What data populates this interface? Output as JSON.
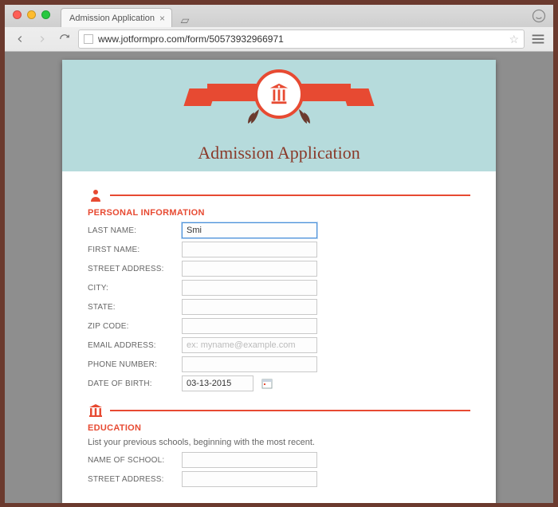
{
  "browser": {
    "tab_title": "Admission Application",
    "url": "www.jotformpro.com/form/50573932966971"
  },
  "banner": {
    "title": "Admission Application"
  },
  "sections": {
    "personal": {
      "title": "PERSONAL INFORMATION",
      "fields": {
        "last_name": {
          "label": "LAST NAME:",
          "value": "Smi"
        },
        "first_name": {
          "label": "FIRST NAME:",
          "value": ""
        },
        "street_address": {
          "label": "STREET ADDRESS:",
          "value": ""
        },
        "city": {
          "label": "CITY:",
          "value": ""
        },
        "state": {
          "label": "STATE:",
          "value": ""
        },
        "zip": {
          "label": "ZIP CODE:",
          "value": ""
        },
        "email": {
          "label": "EMAIL ADDRESS:",
          "value": "",
          "placeholder": "ex: myname@example.com"
        },
        "phone": {
          "label": "PHONE NUMBER:",
          "value": ""
        },
        "dob": {
          "label": "DATE OF BIRTH:",
          "value": "03-13-2015"
        }
      }
    },
    "education": {
      "title": "EDUCATION",
      "note": "List your previous schools, beginning with the most recent.",
      "fields": {
        "school_name": {
          "label": "NAME OF SCHOOL:",
          "value": ""
        },
        "street_address": {
          "label": "STREET ADDRESS:",
          "value": ""
        }
      }
    }
  }
}
